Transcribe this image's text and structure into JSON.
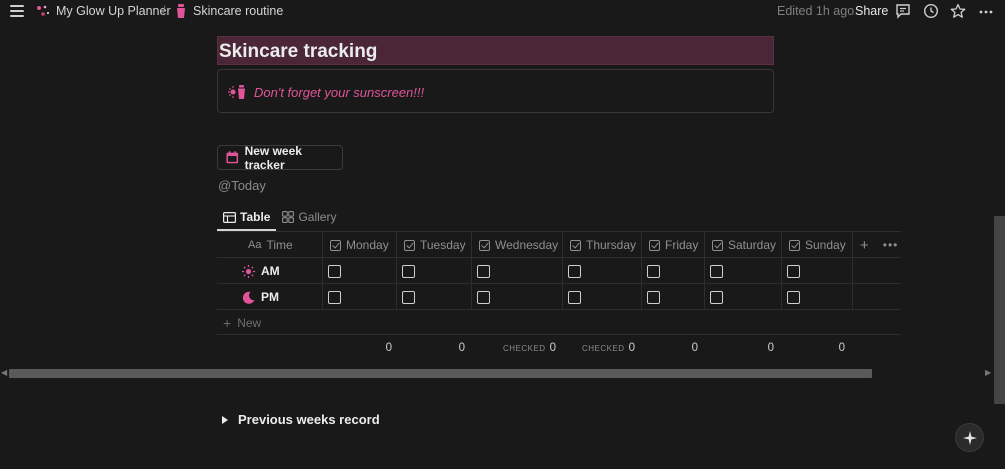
{
  "topbar": {
    "breadcrumb": [
      {
        "label": "My Glow Up Planner",
        "icon": "sparkles-icon"
      },
      {
        "label": "Skincare routine",
        "icon": "lotion-bottle-icon"
      }
    ],
    "separator": "/",
    "edited": "Edited 1h ago",
    "share": "Share",
    "icons": [
      "comments-icon",
      "clock-icon",
      "star-icon",
      "more-icon"
    ]
  },
  "page": {
    "title": "Skincare tracking",
    "callout": {
      "icon": "sun-lotion-icon",
      "text": "Don't forget your sunscreen!!!"
    },
    "new_week_button": "New week tracker",
    "today_mention": "@Today"
  },
  "views": {
    "tabs": [
      {
        "label": "Table",
        "icon": "table-icon",
        "active": true
      },
      {
        "label": "Gallery",
        "icon": "gallery-icon",
        "active": false
      }
    ]
  },
  "table": {
    "time_header": "Time",
    "days": [
      "Monday",
      "Tuesday",
      "Wednesday",
      "Thursday",
      "Friday",
      "Saturday",
      "Sunday"
    ],
    "rows": [
      {
        "label": "AM",
        "icon": "sun-icon",
        "checked": [
          false,
          false,
          false,
          false,
          false,
          false,
          false
        ]
      },
      {
        "label": "PM",
        "icon": "moon-icon",
        "checked": [
          false,
          false,
          false,
          false,
          false,
          false,
          false
        ]
      }
    ],
    "add_new": "New",
    "calculations": [
      {
        "label": "",
        "value": "0"
      },
      {
        "label": "",
        "value": "0"
      },
      {
        "label": "CHECKED",
        "value": "0"
      },
      {
        "label": "CHECKED",
        "value": "0"
      },
      {
        "label": "",
        "value": "0"
      },
      {
        "label": "",
        "value": "0"
      },
      {
        "label": "",
        "value": "0"
      }
    ]
  },
  "toggle": {
    "label": "Previous weeks record"
  },
  "colors": {
    "accent": "#e0559a",
    "title_bg": "#4a2636",
    "background": "#191919"
  }
}
